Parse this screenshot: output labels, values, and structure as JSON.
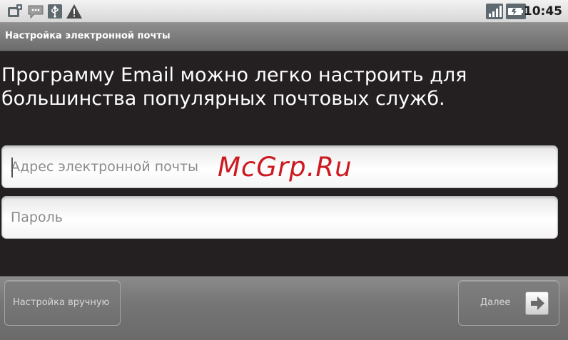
{
  "status_bar": {
    "time": "10:45",
    "left_icons": [
      "new-email-icon",
      "chat-icon",
      "usb-icon",
      "warning-icon"
    ],
    "right_icons": [
      "signal-icon",
      "battery-icon"
    ]
  },
  "title_bar": {
    "title": "Настройка электронной почты"
  },
  "intro": {
    "text": "Программу Email можно легко настроить для большинства популярных почтовых служб."
  },
  "form": {
    "email": {
      "placeholder": "Адрес электронной почты",
      "value": ""
    },
    "password": {
      "placeholder": "Пароль",
      "value": ""
    }
  },
  "watermark": "McGrp.Ru",
  "buttons": {
    "manual_setup": "Настройка вручную",
    "next": "Далее"
  },
  "colors": {
    "background": "#241f20",
    "watermark": "#cc1a20"
  }
}
